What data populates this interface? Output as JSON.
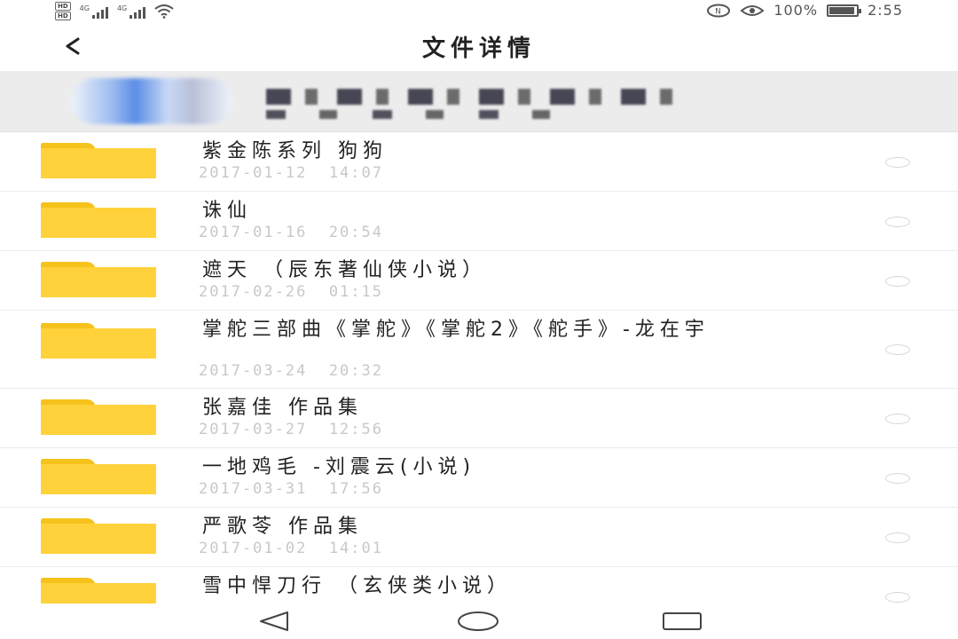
{
  "status_bar": {
    "hd_1": "HD",
    "hd_2": "HD",
    "network_1": "4G",
    "network_2": "4G",
    "battery_percent": "100%",
    "battery_level": 1.0,
    "time": "2:55"
  },
  "header": {
    "title": "文件详情"
  },
  "icons": {
    "back": "back-arrow-icon",
    "folder": "folder-icon",
    "nav_back": "triangle-back-icon",
    "nav_home": "circle-home-icon",
    "nav_recent": "square-recent-icon"
  },
  "colors": {
    "folder_body": "#ffd23b",
    "folder_tab": "#f6c21c",
    "date_text": "#c8c8c8",
    "account_bar_bg": "#ececec"
  },
  "files": [
    {
      "name": "紫金陈系列 狗狗",
      "date": "2017-01-12  14:07"
    },
    {
      "name": "诛仙",
      "date": "2017-01-16  20:54"
    },
    {
      "name": "遮天 （辰东著仙侠小说）",
      "date": "2017-02-26  01:15"
    },
    {
      "name": "掌舵三部曲《掌舵》《掌舵2》《舵手》-龙在宇",
      "date": "2017-03-24  20:32"
    },
    {
      "name": "张嘉佳 作品集",
      "date": "2017-03-27  12:56"
    },
    {
      "name": "一地鸡毛 -刘震云(小说)",
      "date": "2017-03-31  17:56"
    },
    {
      "name": "严歌苓 作品集",
      "date": "2017-01-02  14:01"
    },
    {
      "name": "雪中悍刀行 （玄侠类小说）",
      "date": ""
    }
  ]
}
